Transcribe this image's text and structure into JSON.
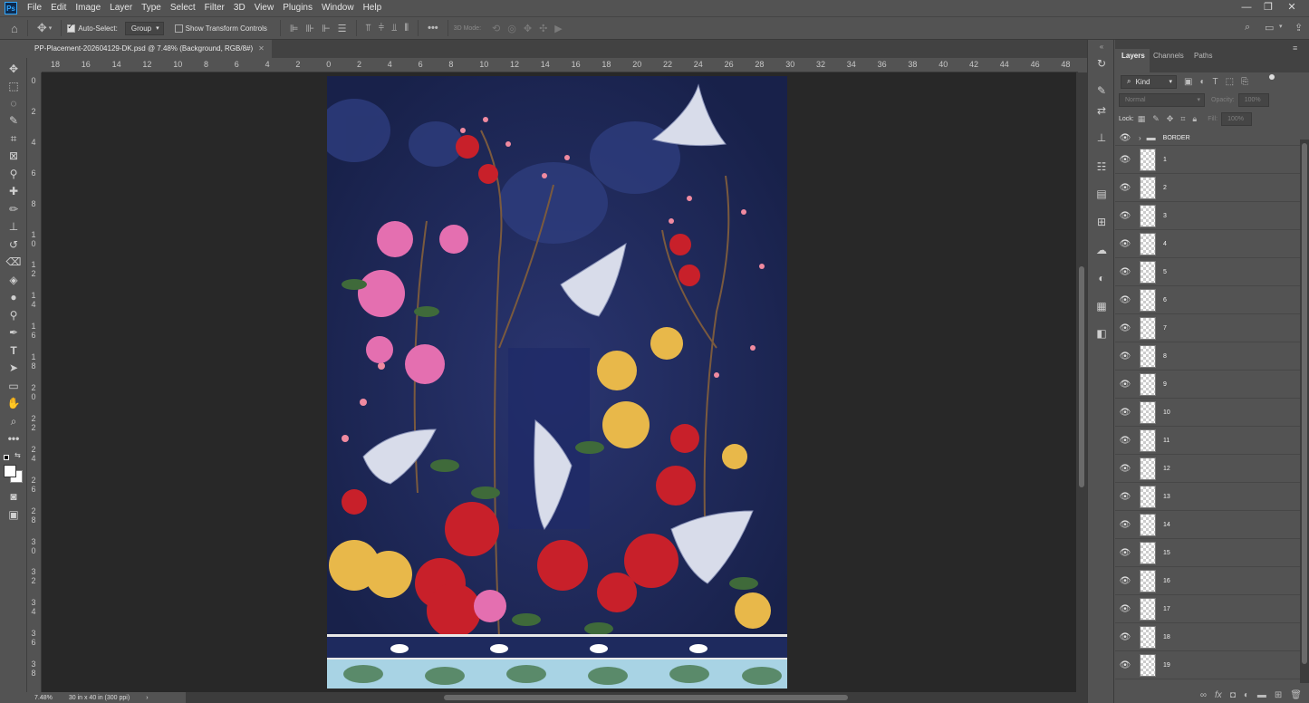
{
  "menubar": {
    "app_icon": "Ps",
    "items": [
      "File",
      "Edit",
      "Image",
      "Layer",
      "Type",
      "Select",
      "Filter",
      "3D",
      "View",
      "Plugins",
      "Window",
      "Help"
    ],
    "window_controls": [
      "minimize-icon",
      "restore-icon",
      "close-icon"
    ]
  },
  "options": {
    "auto_select_label": "Auto-Select:",
    "auto_select_checked": true,
    "auto_select_mode": "Group",
    "show_transform_label": "Show Transform Controls",
    "show_transform_checked": false,
    "three_d_mode_label": "3D Mode:"
  },
  "document": {
    "tab_title": "PP-Placement-202604129-DK.psd @ 7.48% (Background, RGB/8#)"
  },
  "ruler": {
    "top": [
      "18",
      "16",
      "14",
      "12",
      "10",
      "8",
      "6",
      "4",
      "2",
      "0",
      "2",
      "4",
      "6",
      "8",
      "10",
      "12",
      "14",
      "16",
      "18",
      "20",
      "22",
      "24",
      "26",
      "28",
      "30",
      "32",
      "34",
      "36",
      "38",
      "40",
      "42",
      "44",
      "46",
      "48"
    ],
    "left": [
      "0",
      "2",
      "4",
      "6",
      "8",
      "1 0",
      "1 2",
      "1 4",
      "1 6",
      "1 8",
      "2 0",
      "2 2",
      "2 4",
      "2 6",
      "2 8",
      "3 0",
      "3 2",
      "3 4",
      "3 6",
      "3 8"
    ]
  },
  "status": {
    "zoom": "7.48%",
    "doc_size": "30 in x 40 in (300 ppi)"
  },
  "layers_panel": {
    "tabs": [
      "Layers",
      "Channels",
      "Paths"
    ],
    "filter_kind": "Kind",
    "blend_mode": "Normal",
    "opacity_label": "Opacity:",
    "opacity_value": "100%",
    "lock_label": "Lock:",
    "fill_label": "Fill:",
    "fill_value": "100%",
    "group_name": "BORDER",
    "layers": [
      "1",
      "2",
      "3",
      "4",
      "5",
      "6",
      "7",
      "8",
      "9",
      "10",
      "11",
      "12",
      "13",
      "14",
      "15",
      "16",
      "17",
      "18",
      "19"
    ]
  },
  "colors": {
    "artwork_background": "#1b2550",
    "ui_panel": "#535353",
    "canvas_backdrop": "#282828"
  }
}
